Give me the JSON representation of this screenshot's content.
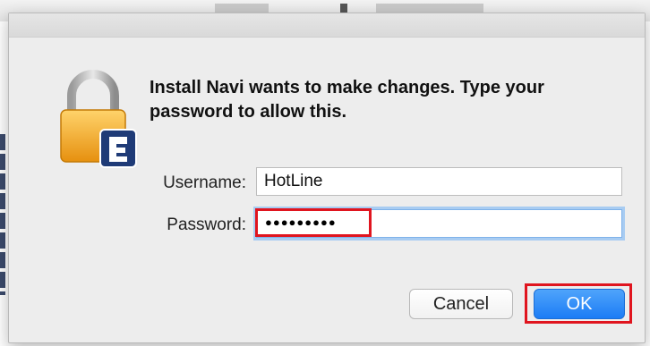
{
  "dialog": {
    "message": "Install Navi wants to make changes. Type your password to allow this.",
    "icon": "lock-icon"
  },
  "form": {
    "username_label": "Username:",
    "username_value": "HotLine",
    "password_label": "Password:",
    "password_value": "●●●●●●●●●"
  },
  "buttons": {
    "cancel_label": "Cancel",
    "ok_label": "OK"
  },
  "colors": {
    "highlight_red": "#e0151f",
    "ok_blue": "#1c7cf5",
    "lock_gold": "#f2a21a",
    "badge_navy": "#1f3b77"
  }
}
